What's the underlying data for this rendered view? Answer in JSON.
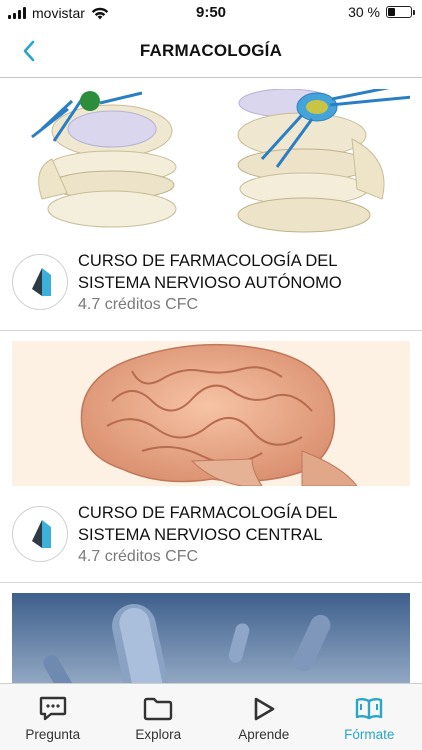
{
  "status_bar": {
    "carrier": "movistar",
    "time": "9:50",
    "battery_text": "30 %",
    "battery_level": 0.3
  },
  "header": {
    "title": "FARMACOLOGÍA",
    "back_icon": "chevron-left-icon"
  },
  "courses": [
    {
      "title": "CURSO DE FARMACOLOGÍA DEL SISTEMA NERVIOSO AUTÓNOMO",
      "credits": "4.7 créditos CFC"
    },
    {
      "title": "CURSO DE FARMACOLOGÍA DEL SISTEMA NERVIOSO CENTRAL",
      "credits": "4.7 créditos CFC"
    }
  ],
  "tab_bar": {
    "tabs": [
      {
        "label": "Pregunta",
        "icon": "chat-bubble-icon"
      },
      {
        "label": "Explora",
        "icon": "folder-icon"
      },
      {
        "label": "Aprende",
        "icon": "play-icon"
      },
      {
        "label": "Fórmate",
        "icon": "book-icon"
      }
    ],
    "active_tab": "Fórmate"
  },
  "colors": {
    "accent": "#2aa6c7",
    "logo_dark": "#2e3a46",
    "logo_light": "#3bb0d8"
  }
}
